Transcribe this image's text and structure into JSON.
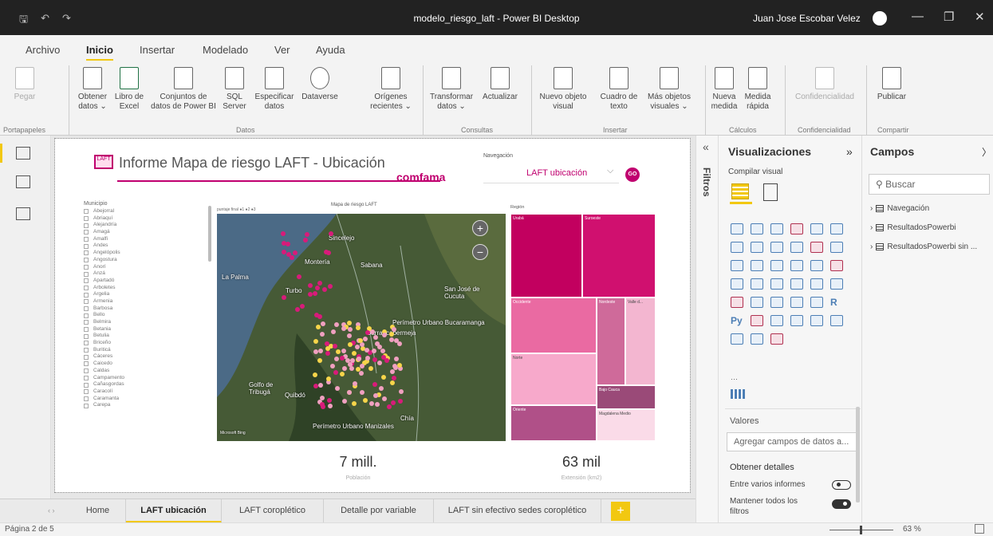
{
  "window": {
    "title": "modelo_riesgo_laft - Power BI Desktop",
    "user": "Juan Jose Escobar Velez",
    "controls": [
      "—",
      "❐",
      "✕"
    ]
  },
  "menu": {
    "items": [
      "Archivo",
      "Inicio",
      "Insertar",
      "Modelado",
      "Ver",
      "Ayuda"
    ],
    "active": "Inicio"
  },
  "ribbon": {
    "buttons": [
      {
        "label": "Pegar",
        "enabled": false
      },
      {
        "label": "Obtener datos ⌄"
      },
      {
        "label": "Libro de Excel"
      },
      {
        "label": "Conjuntos de datos de Power BI"
      },
      {
        "label": "SQL Server"
      },
      {
        "label": "Especificar datos"
      },
      {
        "label": "Dataverse"
      },
      {
        "label": "Orígenes recientes ⌄"
      },
      {
        "label": "Transformar datos ⌄"
      },
      {
        "label": "Actualizar"
      },
      {
        "label": "Nuevo objeto visual"
      },
      {
        "label": "Cuadro de texto"
      },
      {
        "label": "Más objetos visuales ⌄"
      },
      {
        "label": "Nueva medida"
      },
      {
        "label": "Medida rápida"
      },
      {
        "label": "Confidencialidad",
        "enabled": false
      },
      {
        "label": "Publicar"
      }
    ],
    "groups": [
      "Portapapeles",
      "Datos",
      "Consultas",
      "Insertar",
      "Cálculos",
      "Confidencialidad",
      "Compartir"
    ]
  },
  "report": {
    "title": "Informe Mapa de riesgo LAFT - Ubicación",
    "brand": "comfama",
    "navigation_label": "Navegación",
    "navigation_value": "LAFT ubicación",
    "go_label": "GO",
    "slicer_title": "Municipio",
    "municipios": [
      "Abejorral",
      "Abriaquí",
      "Alejandría",
      "Amagá",
      "Amalfi",
      "Andes",
      "Angelópolis",
      "Angostura",
      "Anorí",
      "Anzá",
      "Apartadó",
      "Arboletes",
      "Argelia",
      "Armenia",
      "Barbosa",
      "Bello",
      "Belmira",
      "Betania",
      "Betulia",
      "Briceño",
      "Buriticá",
      "Cáceres",
      "Caicedo",
      "Caldas",
      "Campamento",
      "Cañasgordas",
      "Caracolí",
      "Caramanta",
      "Carepa"
    ],
    "map_title": "Mapa de riesgo LAFT",
    "map_legend": "puntaje final  ●1 ●2 ●3",
    "map_labels": [
      "La Palma",
      "Turbo",
      "Sincelejo",
      "Montería",
      "Sabana",
      "San José de Cucuta",
      "Perímetro Urbano Bucaramanga",
      "Barrancabermeja",
      "Golfo de Tribugá",
      "Quibdó",
      "Perímetro Urbano Manizales",
      "Chía"
    ],
    "zoom_in": "+",
    "zoom_out": "−",
    "map_brand": "Microsoft Bing",
    "treemap_title": "Región",
    "treemap_labels": [
      "Urabá",
      "Suroeste",
      "Occidente",
      "Nordeste",
      "Valle d...",
      "Norte",
      "Bajo Cauca",
      "Oriente",
      "Magdalena Medio"
    ],
    "kpi_population_value": "7 mill.",
    "kpi_population_label": "Población",
    "kpi_area_value": "63 mil",
    "kpi_area_label": "Extensión (km2)"
  },
  "pages": {
    "arrows": "‹ ›",
    "tabs": [
      "Home",
      "LAFT ubicación",
      "LAFT coroplético",
      "Detalle por variable",
      "LAFT sin efectivo sedes coroplético"
    ],
    "active": "LAFT ubicación",
    "add": "+"
  },
  "filters": {
    "label": "Filtros",
    "collapse": "«"
  },
  "viz": {
    "title": "Visualizaciones",
    "expand": "»",
    "build_label": "Compilar visual",
    "values_label": "Valores",
    "add_fields": "Agregar campos de datos a...",
    "drill_label": "Obtener detalles",
    "cross_report": "Entre varios informes",
    "keep_filters": "Mantener todos los filtros",
    "more": "···"
  },
  "fields": {
    "title": "Campos",
    "collapse": "〉",
    "search_placeholder": "Buscar",
    "tables": [
      "Navegación",
      "ResultadosPowerbi",
      "ResultadosPowerbi sin ..."
    ]
  },
  "status": {
    "page": "Página 2 de 5",
    "zoom": "63 %"
  },
  "colors": {
    "accent": "#f2c811",
    "brand": "#c0006f"
  }
}
